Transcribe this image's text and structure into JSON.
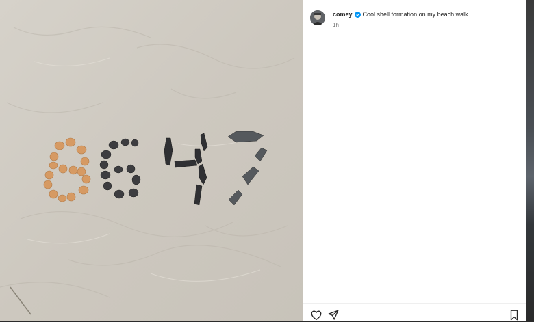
{
  "post": {
    "username": "comey",
    "verified": true,
    "caption": "Cool shell formation on my beach walk",
    "timestamp": "1h",
    "image_alt": "Shells arranged in the sand spelling 8647"
  },
  "actions": {
    "like_icon": "heart-outline-icon",
    "share_icon": "paper-plane-icon",
    "save_icon": "bookmark-icon"
  },
  "colors": {
    "verified_badge": "#0095f6",
    "text_primary": "#262626",
    "text_secondary": "#737373"
  }
}
